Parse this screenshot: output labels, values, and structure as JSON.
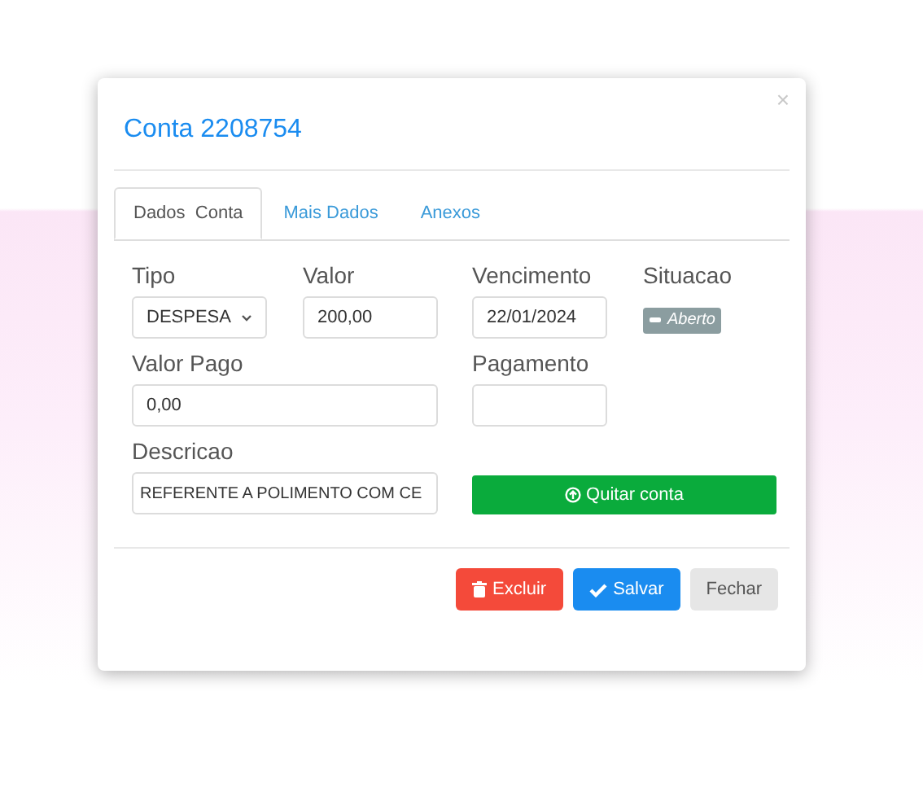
{
  "dialog": {
    "title": "Conta 2208754",
    "close": "×"
  },
  "tabs": [
    {
      "label": "Dados  Conta",
      "selected": true
    },
    {
      "label": "Mais Dados",
      "selected": false
    },
    {
      "label": "Anexos",
      "selected": false
    }
  ],
  "form": {
    "tipo": {
      "label": "Tipo",
      "value": "DESPESA"
    },
    "valor": {
      "label": "Valor",
      "value": "200,00"
    },
    "vencimento": {
      "label": "Vencimento",
      "value": "22/01/2024"
    },
    "situacao": {
      "label": "Situacao",
      "status": "Aberto"
    },
    "valor_pago": {
      "label": "Valor Pago",
      "value": "0,00"
    },
    "pagamento": {
      "label": "Pagamento"
    },
    "descricao": {
      "label": "Descricao",
      "value": "REFERENTE A POLIMENTO COM CE"
    },
    "quitar_button": "Quitar conta"
  },
  "buttons": [
    {
      "kind": "delete",
      "label": "Excluir"
    },
    {
      "kind": "save",
      "label": "Salvar"
    },
    {
      "kind": "close",
      "label": "Fechar"
    }
  ]
}
